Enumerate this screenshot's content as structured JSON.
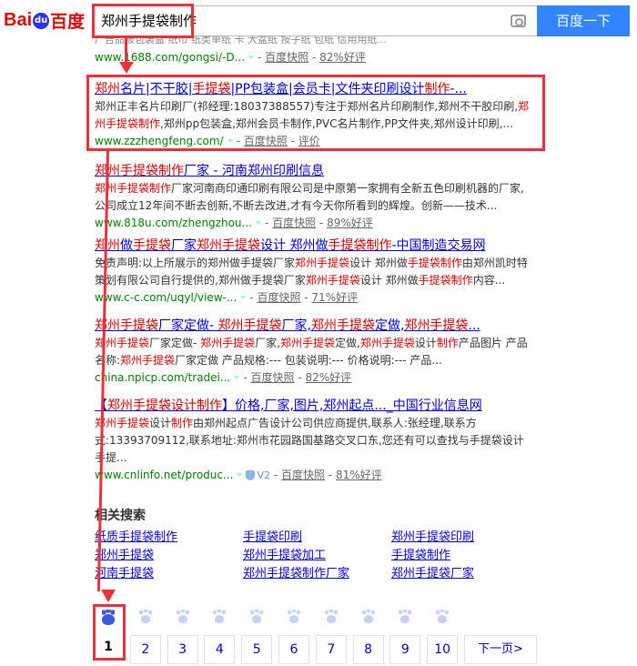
{
  "header": {
    "logo_bai": "Bai",
    "logo_paw": "du",
    "logo_du": "百度",
    "query": "郑州手提袋制作",
    "search_button": "百度一下"
  },
  "results": [
    {
      "title": "广告品被包装盒 纸币 纸类单纸 卡 大盆纸 按子纸 包纸 信用用纸...",
      "abstract": "",
      "url": "www.1688.com/gongsi/-D...",
      "snapshot": "百度快照",
      "rating": "82%好评"
    },
    {
      "title_parts": [
        {
          "t": "郑州",
          "em": true
        },
        {
          "t": "名片|不干胶|",
          "em": false
        },
        {
          "t": "手提袋",
          "em": true
        },
        {
          "t": "|PP包装盒|会员卡|文件夹印刷设计",
          "em": false
        },
        {
          "t": "制作",
          "em": true
        },
        {
          "t": "-...",
          "em": false
        }
      ],
      "abstract_parts": [
        {
          "t": "郑州正丰名片印刷厂(祁经理:18037388557)专注于郑州名片印刷制作,郑州不干胶印刷,",
          "em": false
        },
        {
          "t": "郑州手提袋制作",
          "em": true
        },
        {
          "t": ",郑州pp包装盒,郑州会员卡制作,PVC名片制作,PP文件夹,郑州设计印刷,...",
          "em": false
        }
      ],
      "url": "www.zzzhengfeng.com/",
      "snapshot": "百度快照",
      "rating": "评价"
    },
    {
      "title_parts": [
        {
          "t": "郑州手提袋制作",
          "em": true
        },
        {
          "t": "厂家 - 河南郑州印刷信息",
          "em": false
        }
      ],
      "abstract_parts": [
        {
          "t": "郑州手提袋制作",
          "em": true
        },
        {
          "t": "厂家河南商印通印刷有限公司是中原第一家拥有全新五色印刷机器的厂家,公司成立12年间不断去创新,不断去改进,才有今天你所看到的辉煌。创新——技术...",
          "em": false
        }
      ],
      "url": "www.818u.com/zhengzhou...",
      "snapshot": "百度快照",
      "rating": "89%好评"
    },
    {
      "title_parts": [
        {
          "t": "郑州",
          "em": true
        },
        {
          "t": "做",
          "em": false
        },
        {
          "t": "手提袋",
          "em": true
        },
        {
          "t": "厂家",
          "em": false
        },
        {
          "t": "郑州手提袋",
          "em": true
        },
        {
          "t": "设计 郑州做",
          "em": false
        },
        {
          "t": "手提袋制作",
          "em": true
        },
        {
          "t": "-中国制造交易网",
          "em": false
        }
      ],
      "abstract_parts": [
        {
          "t": "免责声明:以上所展示的郑州做手提袋厂家",
          "em": false
        },
        {
          "t": "郑州手提袋",
          "em": true
        },
        {
          "t": "设计 郑州做",
          "em": false
        },
        {
          "t": "手提袋制作",
          "em": true
        },
        {
          "t": "由郑州凯时特策划有限公司自行提供的,郑州做手提袋厂家",
          "em": false
        },
        {
          "t": "郑州手提袋",
          "em": true
        },
        {
          "t": "设计 郑州做",
          "em": false
        },
        {
          "t": "手提袋制作",
          "em": true
        },
        {
          "t": "内容...",
          "em": false
        }
      ],
      "url": "www.c-c.com/uqyl/view-...",
      "snapshot": "百度快照",
      "rating": "71%好评"
    },
    {
      "title_parts": [
        {
          "t": "郑州手提袋",
          "em": true
        },
        {
          "t": "厂家定做- ",
          "em": false
        },
        {
          "t": "郑州手提袋",
          "em": true
        },
        {
          "t": "厂家,",
          "em": false
        },
        {
          "t": "郑州手提袋",
          "em": true
        },
        {
          "t": "定做,",
          "em": false
        },
        {
          "t": "郑州手提袋",
          "em": true
        },
        {
          "t": "...",
          "em": false
        }
      ],
      "abstract_parts": [
        {
          "t": "郑州手提袋",
          "em": true
        },
        {
          "t": "厂家定做- ",
          "em": false
        },
        {
          "t": "郑州手提袋",
          "em": true
        },
        {
          "t": "厂家,",
          "em": false
        },
        {
          "t": "郑州手提袋",
          "em": true
        },
        {
          "t": "定做,",
          "em": false
        },
        {
          "t": "郑州手提袋",
          "em": true
        },
        {
          "t": "设计",
          "em": false
        },
        {
          "t": "制作",
          "em": true
        },
        {
          "t": "产品图片 产品名称:",
          "em": false
        },
        {
          "t": "郑州手提袋",
          "em": true
        },
        {
          "t": "厂家定做 产品规格:--- 包装说明:--- 价格说明:--- 产品...",
          "em": false
        }
      ],
      "url": "china.npicp.com/tradei...",
      "snapshot": "百度快照",
      "rating": "82%好评"
    },
    {
      "title_parts": [
        {
          "t": "【",
          "em": false
        },
        {
          "t": "郑州手提袋设计制作",
          "em": true
        },
        {
          "t": "】价格,厂家,图片,郑州起点..._中国行业信息网",
          "em": false
        }
      ],
      "abstract_parts": [
        {
          "t": "郑州手提袋",
          "em": true
        },
        {
          "t": "设计",
          "em": false
        },
        {
          "t": "制作",
          "em": true
        },
        {
          "t": "由郑州起点广告设计公司供应商提供,联系人:张经理,联系方式:13393709112,联系地址:郑州市花园路国基路交叉口东,您还有可以查找与手提袋设计 手提...",
          "em": false
        }
      ],
      "url": "www.cnlinfo.net/produc...",
      "v2": "V2",
      "snapshot": "百度快照",
      "rating": "81%好评"
    }
  ],
  "related": {
    "title": "相关搜索",
    "items": [
      "纸质手提袋制作",
      "手提袋印刷",
      "郑州手提袋印刷",
      "郑州手提袋",
      "郑州手提袋加工",
      "手提袋制作",
      "河南手提袋",
      "郑州手提袋制作厂家",
      "郑州手提袋厂家"
    ]
  },
  "pager": {
    "pages": [
      "1",
      "2",
      "3",
      "4",
      "5",
      "6",
      "7",
      "8",
      "9",
      "10"
    ],
    "current": "1",
    "next": "下一页>"
  },
  "colors": {
    "link": "#0000cc",
    "highlight": "#cc0000",
    "url": "#008000",
    "annotation": "#e8313a",
    "button": "#3385ff"
  }
}
